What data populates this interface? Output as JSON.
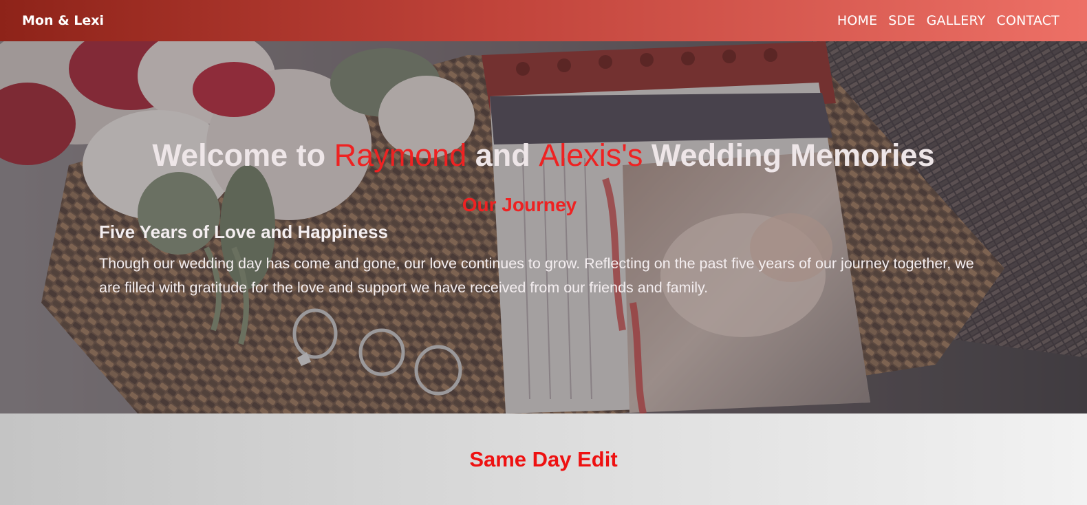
{
  "nav": {
    "brand": "Mon & Lexi",
    "links": [
      "HOME",
      "SDE",
      "GALLERY",
      "CONTACT"
    ]
  },
  "hero": {
    "title_prefix": "Welcome to ",
    "name1": "Raymond",
    "title_and": " and ",
    "name2": "Alexis's",
    "title_suffix": " Wedding Memories",
    "section_title": "Our Journey",
    "subtitle": "Five Years of Love and Happiness",
    "body": "Though our wedding day has come and gone, our love continues to grow. Reflecting on the past five years of our journey together, we are filled with gratitude for the love and support we have received from our friends and family."
  },
  "sde": {
    "title": "Same Day Edit"
  },
  "colors": {
    "accent_red": "#ee2222",
    "nav_gradient_start": "#8e2319",
    "nav_gradient_end": "#ed7066"
  },
  "icons": {
    "hero_image": "wedding-invitation-rings-photo"
  }
}
